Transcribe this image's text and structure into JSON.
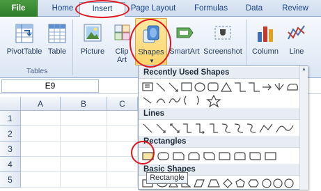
{
  "tabs": [
    "File",
    "Home",
    "Insert",
    "Page Layout",
    "Formulas",
    "Data",
    "Review"
  ],
  "ribbon": {
    "pivot_label": "PivotTable",
    "table_label": "Table",
    "group_tables": "Tables",
    "picture_label": "Picture",
    "clipart_label": "Clip Art",
    "shapes_label": "Shapes",
    "smartart_label": "SmartArt",
    "screenshot_label": "Screenshot",
    "column_label": "Column",
    "line_label": "Line"
  },
  "namebox": "E9",
  "columns": [
    "A",
    "B",
    "C"
  ],
  "rows": [
    "1",
    "2",
    "3",
    "4",
    "5"
  ],
  "dropdown": {
    "recent": "Recently Used Shapes",
    "lines": "Lines",
    "rectangles": "Rectangles",
    "basic": "Basic Shapes"
  },
  "tooltip": "Rectangle",
  "colors": {
    "accent_red": "#e0151c",
    "file_green": "#2e7d2c"
  }
}
